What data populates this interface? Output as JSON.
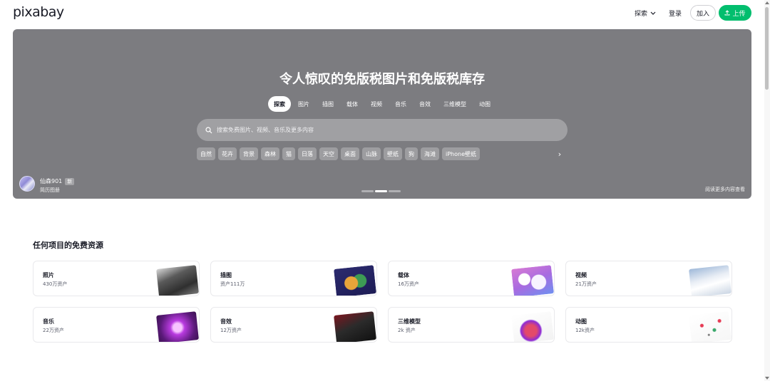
{
  "header": {
    "logo": "pixabay",
    "explore": "探索",
    "login": "登录",
    "join": "加入",
    "upload": "上传"
  },
  "hero": {
    "title": "令人惊叹的免版税图片和免版税库存",
    "tabs": [
      "探索",
      "图片",
      "插图",
      "载体",
      "视频",
      "音乐",
      "音效",
      "三维模型",
      "动图"
    ],
    "active_tab": "探索",
    "search_placeholder": "搜索免费图片、视频、音乐及更多内容",
    "chips": [
      "自然",
      "花卉",
      "背景",
      "森林",
      "猫",
      "日落",
      "天空",
      "桌面",
      "山脉",
      "壁纸",
      "狗",
      "海滩",
      "iPhone壁纸"
    ],
    "credit": {
      "name": "仙森901",
      "badge": "新",
      "sub": "简历图册"
    },
    "slides_total": 3,
    "slide_active": 2,
    "read_more": "阅读更多内容查看"
  },
  "section": {
    "title": "任何项目的免费资源",
    "cards": [
      {
        "label": "照片",
        "count": "430万资产",
        "thumb": "photos"
      },
      {
        "label": "插图",
        "count": "资产111万",
        "thumb": "illus"
      },
      {
        "label": "载体",
        "count": "16万资产",
        "thumb": "vector"
      },
      {
        "label": "视频",
        "count": "21万资产",
        "thumb": "video"
      },
      {
        "label": "音乐",
        "count": "22万资产",
        "thumb": "music"
      },
      {
        "label": "音效",
        "count": "12万资产",
        "thumb": "sfx"
      },
      {
        "label": "三维模型",
        "count": "2k 资产",
        "thumb": "3d"
      },
      {
        "label": "动图",
        "count": "12k资产",
        "thumb": "gif"
      }
    ]
  },
  "colors": {
    "accent": "#02be6e",
    "hero_bg": "#7c7c80",
    "text": "#191b26"
  },
  "icons": {
    "explore": "chevron-down-icon",
    "upload": "upload-icon",
    "search": "search-icon",
    "chips_next": "chevron-right-icon"
  }
}
